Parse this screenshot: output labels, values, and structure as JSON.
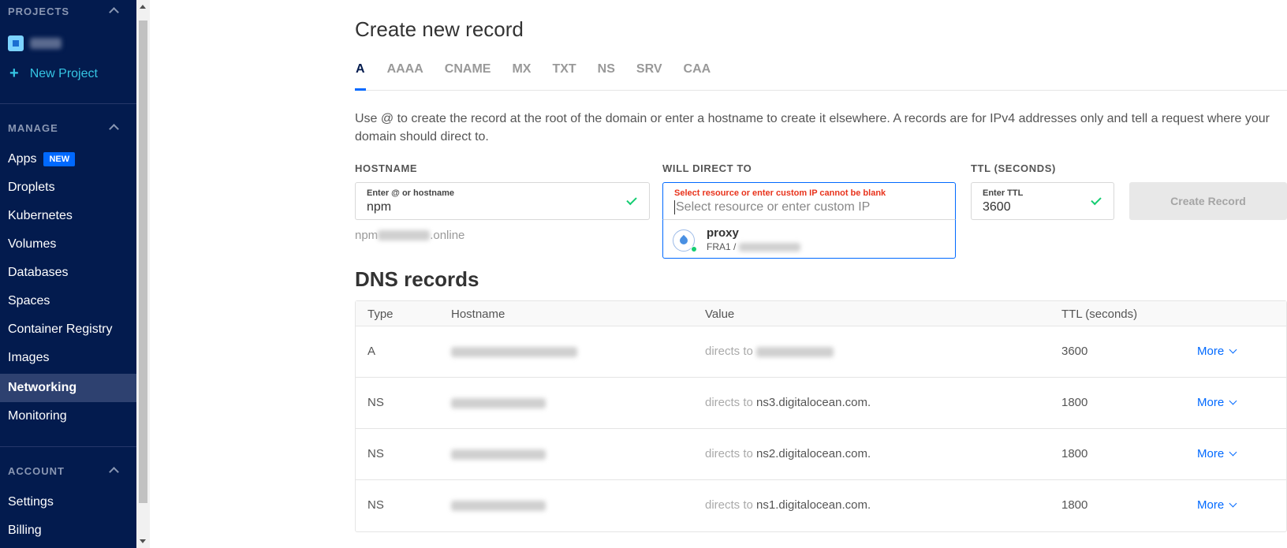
{
  "sidebar": {
    "projects_header": "PROJECTS",
    "new_project": "New Project",
    "manage_header": "MANAGE",
    "account_header": "ACCOUNT",
    "manage_items": [
      {
        "label": "Apps",
        "badge": "NEW"
      },
      {
        "label": "Droplets"
      },
      {
        "label": "Kubernetes"
      },
      {
        "label": "Volumes"
      },
      {
        "label": "Databases"
      },
      {
        "label": "Spaces"
      },
      {
        "label": "Container Registry"
      },
      {
        "label": "Images"
      },
      {
        "label": "Networking",
        "active": true
      },
      {
        "label": "Monitoring"
      }
    ],
    "account_items": [
      {
        "label": "Settings"
      },
      {
        "label": "Billing"
      }
    ]
  },
  "main": {
    "title": "Create new record",
    "tabs": [
      "A",
      "AAAA",
      "CNAME",
      "MX",
      "TXT",
      "NS",
      "SRV",
      "CAA"
    ],
    "active_tab": "A",
    "description": "Use @ to create the record at the root of the domain or enter a hostname to create it elsewhere. A records are for IPv4 addresses only and tell a request where your domain should direct to.",
    "hostname": {
      "section_label": "HOSTNAME",
      "inner_label": "Enter @ or hostname",
      "value": "npm",
      "preview_prefix": "npm",
      "preview_suffix": ".online"
    },
    "direct_to": {
      "section_label": "WILL DIRECT TO",
      "error": "Select resource or enter custom IP cannot be blank",
      "placeholder": "Select resource or enter custom IP",
      "option_name": "proxy",
      "option_region": "FRA1 /"
    },
    "ttl": {
      "section_label": "TTL (SECONDS)",
      "inner_label": "Enter TTL",
      "value": "3600"
    },
    "create_button": "Create Record",
    "dns_title": "DNS records",
    "table": {
      "headers": [
        "Type",
        "Hostname",
        "Value",
        "TTL (seconds)"
      ],
      "directs_prefix": "directs to",
      "more_label": "More",
      "rows": [
        {
          "type": "A",
          "value": "",
          "ttl": "3600"
        },
        {
          "type": "NS",
          "value": "ns3.digitalocean.com.",
          "ttl": "1800"
        },
        {
          "type": "NS",
          "value": "ns2.digitalocean.com.",
          "ttl": "1800"
        },
        {
          "type": "NS",
          "value": "ns1.digitalocean.com.",
          "ttl": "1800"
        }
      ]
    }
  },
  "colors": {
    "sidebar_bg": "#031b4e",
    "accent": "#0069ff",
    "error": "#e8331c",
    "success": "#15cd72"
  }
}
